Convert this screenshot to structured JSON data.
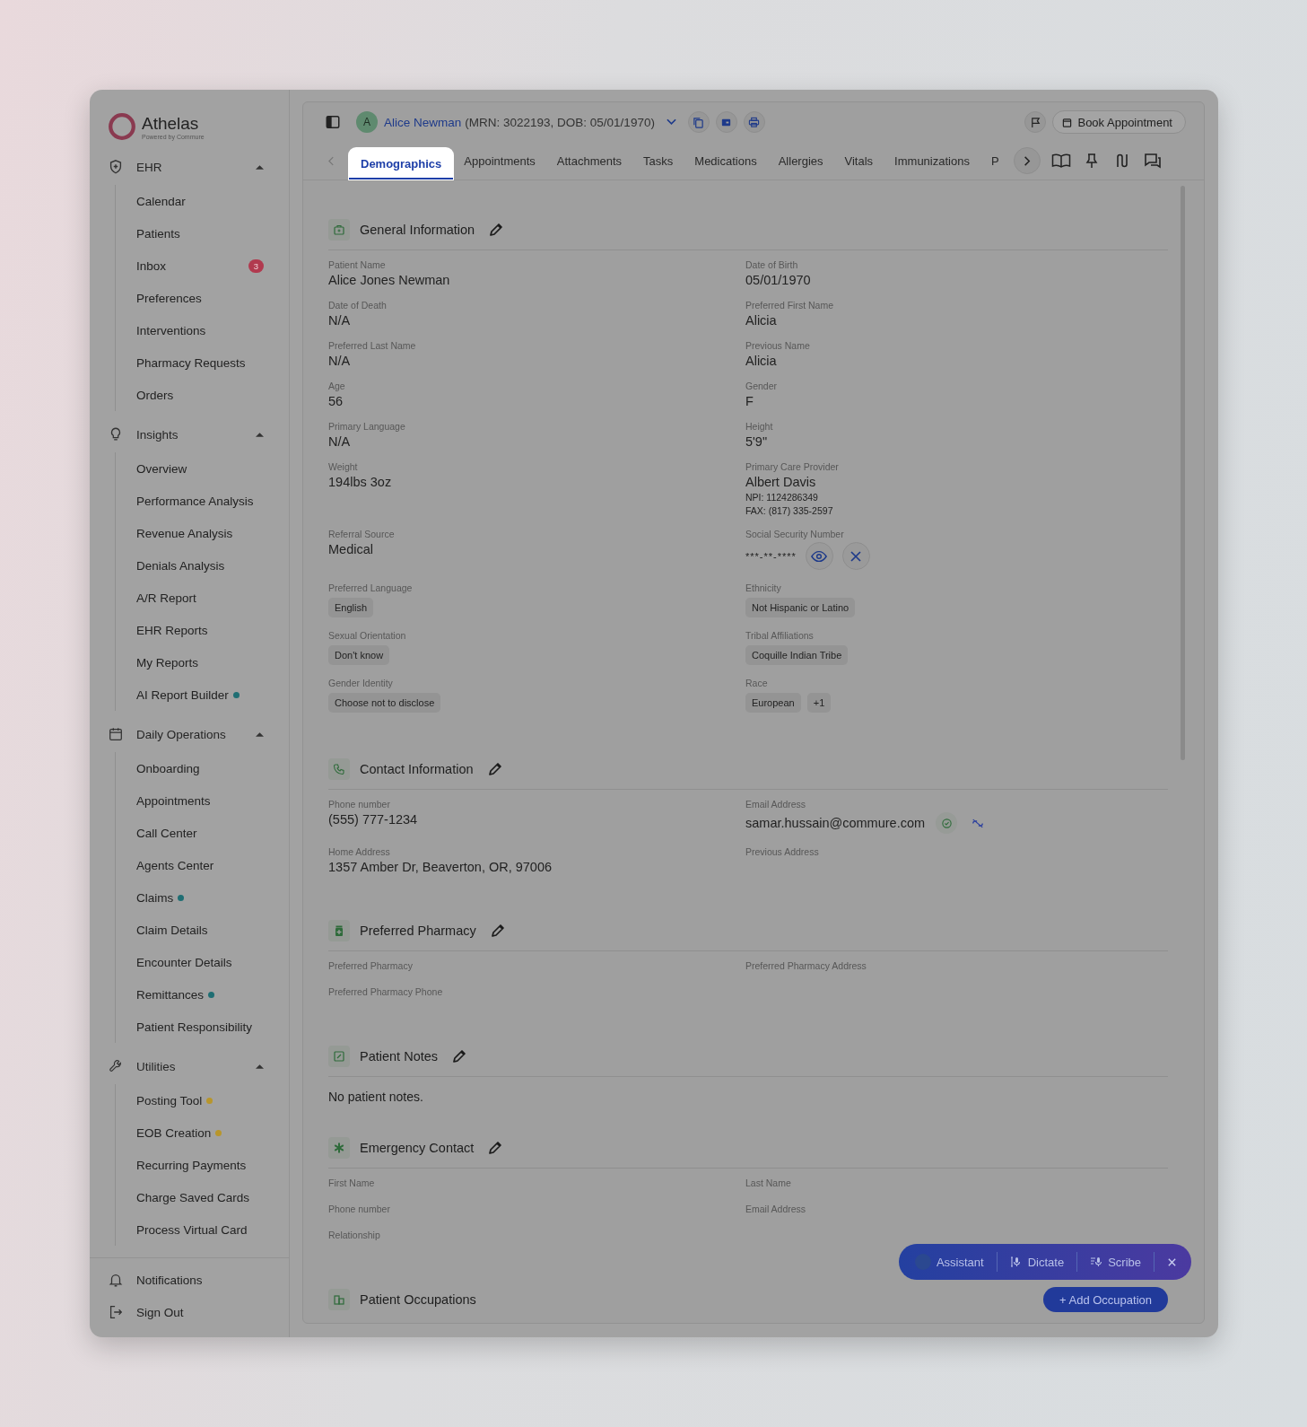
{
  "sidebar": {
    "logo": {
      "name": "Athelas",
      "tagline": "Powered by Commure"
    },
    "groups": [
      {
        "label": "EHR",
        "expanded": true,
        "items": [
          {
            "label": "Calendar"
          },
          {
            "label": "Patients"
          },
          {
            "label": "Inbox",
            "badge": "3"
          },
          {
            "label": "Preferences"
          },
          {
            "label": "Interventions"
          },
          {
            "label": "Pharmacy Requests"
          },
          {
            "label": "Orders"
          }
        ]
      },
      {
        "label": "Insights",
        "expanded": true,
        "items": [
          {
            "label": "Overview"
          },
          {
            "label": "Performance Analysis"
          },
          {
            "label": "Revenue Analysis"
          },
          {
            "label": "Denials Analysis"
          },
          {
            "label": "A/R Report"
          },
          {
            "label": "EHR Reports"
          },
          {
            "label": "My Reports"
          },
          {
            "label": "AI Report Builder",
            "color": "#1f6e73"
          }
        ]
      },
      {
        "label": "Daily Operations",
        "expanded": true,
        "items": [
          {
            "label": "Onboarding"
          },
          {
            "label": "Appointments"
          },
          {
            "label": "Call Center"
          },
          {
            "label": "Agents Center"
          },
          {
            "label": "Claims",
            "color": "#1f6e73"
          },
          {
            "label": "Claim Details"
          },
          {
            "label": "Encounter Details"
          },
          {
            "label": "Remittances",
            "color": "#1f6e73"
          },
          {
            "label": "Patient Responsibility"
          }
        ]
      },
      {
        "label": "Utilities",
        "expanded": true,
        "items": [
          {
            "label": "Posting Tool",
            "color": "#b8962c"
          },
          {
            "label": "EOB Creation",
            "color": "#b8962c"
          },
          {
            "label": "Recurring Payments"
          },
          {
            "label": "Charge Saved Cards"
          },
          {
            "label": "Process Virtual Card"
          }
        ]
      }
    ],
    "footer": [
      {
        "label": "Notifications"
      },
      {
        "label": "Sign Out"
      }
    ]
  },
  "header": {
    "patient": {
      "initial": "A",
      "name": "Alice Newman",
      "details": "(MRN: 3022193, DOB: 05/01/1970)"
    },
    "book_button": "Book Appointment"
  },
  "tabs": [
    {
      "label": "Demographics",
      "selected": true
    },
    {
      "label": "Appointments",
      "selected": false
    },
    {
      "label": "Attachments",
      "selected": false
    },
    {
      "label": "Tasks",
      "selected": false
    },
    {
      "label": "Medications",
      "selected": false
    },
    {
      "label": "Allergies",
      "selected": false
    },
    {
      "label": "Vitals",
      "selected": false
    },
    {
      "label": "Immunizations",
      "selected": false
    },
    {
      "label": "P",
      "selected": false
    }
  ],
  "sections": [
    {
      "title": "General Information",
      "rows": [
        [
          {
            "label": "Patient Name",
            "value": "Alice Jones Newman"
          },
          {
            "label": "Date of Birth",
            "value": "05/01/1970"
          }
        ],
        [
          {
            "label": "Date of Death",
            "value": "N/A"
          },
          {
            "label": "Preferred First Name",
            "value": "Alicia"
          }
        ],
        [
          {
            "label": "Preferred Last Name",
            "value": "N/A"
          },
          {
            "label": "Previous Name",
            "value": "Alicia"
          }
        ],
        [
          {
            "label": "Age",
            "value": "56"
          },
          {
            "label": "Gender",
            "value": "F"
          }
        ],
        [
          {
            "label": "Primary Language",
            "value": "N/A"
          },
          {
            "label": "Height",
            "value": "5'9\""
          }
        ],
        [
          {
            "label": "Weight",
            "value": "194lbs 3oz"
          },
          {
            "label": "Primary Care Provider",
            "value": "Albert Davis",
            "notes": [
              "NPI: 1124286349",
              "FAX: (817) 335-2597"
            ]
          }
        ],
        [
          {
            "label": "Referral Source",
            "value": "Medical"
          },
          {
            "label": "Social Security Number",
            "value": "***-**-****",
            "kind": "masked"
          }
        ],
        [
          {
            "label": "Preferred Language",
            "kind": "chips",
            "chips": [
              "English"
            ]
          },
          {
            "label": "Ethnicity",
            "kind": "chips",
            "chips": [
              "Not Hispanic or Latino"
            ]
          }
        ],
        [
          {
            "label": "Sexual Orientation",
            "kind": "chips",
            "chips": [
              "Don't know"
            ]
          },
          {
            "label": "Tribal Affiliations",
            "kind": "chips",
            "chips": [
              "Coquille Indian Tribe"
            ]
          }
        ],
        [
          {
            "label": "Gender Identity",
            "kind": "chips",
            "chips": [
              "Choose not to disclose"
            ]
          },
          {
            "label": "Race",
            "kind": "chips",
            "chips": [
              "European",
              "+1"
            ]
          }
        ]
      ]
    },
    {
      "title": "Contact Information",
      "rows": [
        [
          {
            "label": "Phone number",
            "value": "(555) 777-1234"
          },
          {
            "label": "Email Address",
            "value": "samar.hussain@commure.com",
            "kind": "email"
          }
        ],
        [
          {
            "label": "Home Address",
            "value": "1357 Amber Dr, Beaverton, OR, 97006"
          },
          {
            "label": "Previous Address"
          }
        ]
      ]
    },
    {
      "title": "Preferred Pharmacy",
      "rows": [
        [
          {
            "label": "Preferred Pharmacy"
          },
          {
            "label": "Preferred Pharmacy Address"
          }
        ],
        [
          {
            "label": "Preferred Pharmacy Phone"
          }
        ]
      ]
    },
    {
      "title": "Patient Notes",
      "note": "No patient notes."
    },
    {
      "title": "Emergency Contact",
      "rows": [
        [
          {
            "label": "First Name"
          },
          {
            "label": "Last Name"
          }
        ],
        [
          {
            "label": "Phone number"
          },
          {
            "label": "Email Address"
          }
        ],
        [
          {
            "label": "Relationship"
          }
        ]
      ]
    },
    {
      "title": "Patient Occupations",
      "action": "+ Add Occupation"
    }
  ],
  "assistant_bar": {
    "items": [
      "Assistant",
      "Dictate",
      "Scribe"
    ]
  }
}
